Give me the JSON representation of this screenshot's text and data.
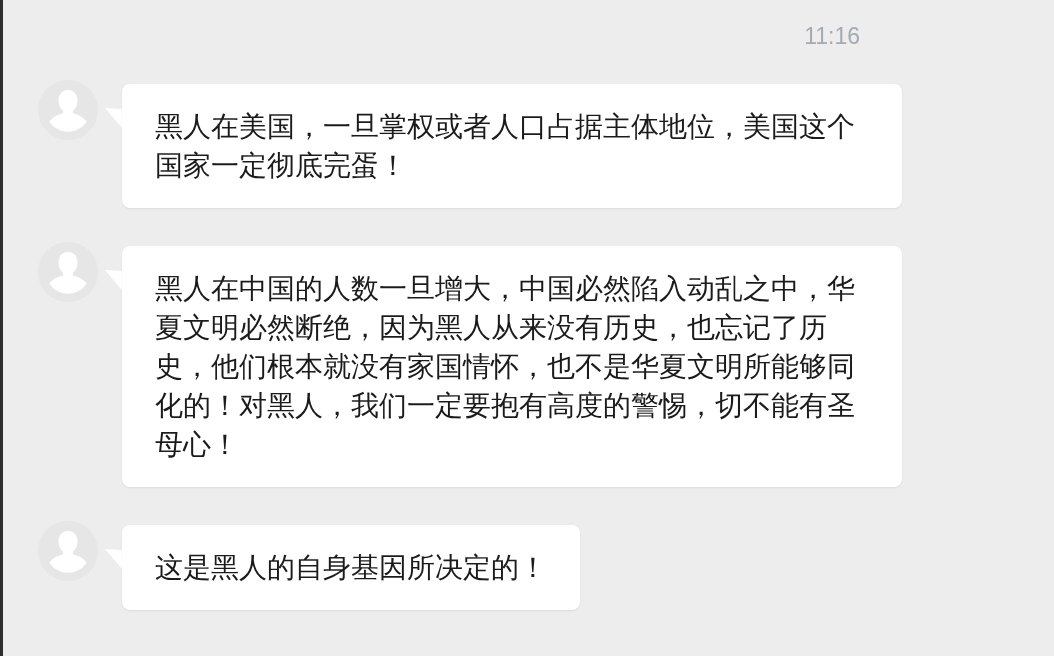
{
  "timestamp": "11:16",
  "messages": [
    {
      "text": "黑人在美国，一旦掌权或者人口占据主体地位，美国这个国家一定彻底完蛋！"
    },
    {
      "text": "黑人在中国的人数一旦增大，中国必然陷入动乱之中，华夏文明必然断绝，因为黑人从来没有历史，也忘记了历史，他们根本就没有家国情怀，也不是华夏文明所能够同化的！对黑人，我们一定要抱有高度的警惕，切不能有圣母心！"
    },
    {
      "text": "这是黑人的自身基因所决定的！"
    }
  ]
}
